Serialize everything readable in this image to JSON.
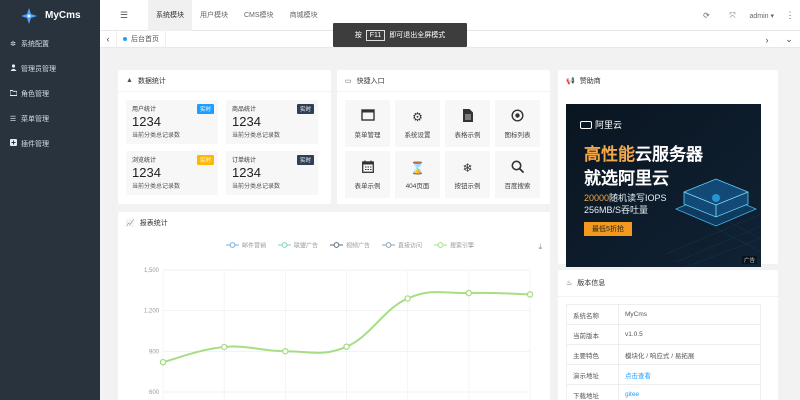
{
  "app": {
    "name": "MyCms"
  },
  "sidebar": {
    "items": [
      {
        "label": "系统配置",
        "icon": "gear-icon"
      },
      {
        "label": "管理员管理",
        "icon": "user-icon"
      },
      {
        "label": "角色管理",
        "icon": "folder-icon"
      },
      {
        "label": "菜单管理",
        "icon": "menu-icon"
      },
      {
        "label": "插件管理",
        "icon": "plus-box-icon"
      }
    ]
  },
  "topbar": {
    "tabs": [
      "系统模块",
      "用户模块",
      "CMS模块",
      "商城模块"
    ],
    "active_tab": "系统模块",
    "user": "admin"
  },
  "tabstrip": {
    "home_tab": "后台首页"
  },
  "toast": {
    "before": "按",
    "key": "F11",
    "after": "即可退出全屏模式"
  },
  "stats": {
    "title": "数据统计",
    "items": [
      {
        "label": "用户统计",
        "badge": "实时",
        "badge_color": "#1e9fff",
        "value": "1234",
        "desc": "当前分类总记录数"
      },
      {
        "label": "商品统计",
        "badge": "实时",
        "badge_color": "#2f4056",
        "value": "1234",
        "desc": "当前分类总记录数"
      },
      {
        "label": "浏览统计",
        "badge": "实时",
        "badge_color": "#ffb800",
        "value": "1234",
        "desc": "当前分类总记录数"
      },
      {
        "label": "订单统计",
        "badge": "实时",
        "badge_color": "#2f4056",
        "value": "1234",
        "desc": "当前分类总记录数"
      }
    ]
  },
  "quick": {
    "title": "快捷入口",
    "items": [
      {
        "label": "菜单管理",
        "icon": "window-icon"
      },
      {
        "label": "系统设置",
        "icon": "gears-icon"
      },
      {
        "label": "表格示例",
        "icon": "file-icon"
      },
      {
        "label": "图标列表",
        "icon": "target-icon"
      },
      {
        "label": "表单示例",
        "icon": "calendar-icon"
      },
      {
        "label": "404页面",
        "icon": "hourglass-icon"
      },
      {
        "label": "按钮示例",
        "icon": "snowflake-icon"
      },
      {
        "label": "百度搜索",
        "icon": "search-icon"
      }
    ]
  },
  "sponsor": {
    "title": "赞助商",
    "brand": "阿里云",
    "headline_hl": "高性能",
    "headline_rest": "云服务器",
    "headline2": "就选阿里云",
    "line1_num": "20000",
    "line1_rest": "随机读写IOPS",
    "line2": "256MB/S吞吐量",
    "button": "最低5折抢",
    "ad_tag": "广告"
  },
  "version": {
    "title": "版本信息",
    "rows": [
      {
        "k": "系统名称",
        "v": "MyCms",
        "link": false
      },
      {
        "k": "当前版本",
        "v": "v1.0.5",
        "link": false
      },
      {
        "k": "主要特色",
        "v": "模块化 / 响应式 / 易拓展",
        "link": false
      },
      {
        "k": "演示地址",
        "v": "点击查看",
        "link": true
      },
      {
        "k": "下载地址",
        "v": "gitee",
        "link": true
      }
    ]
  },
  "report": {
    "title": "报表统计"
  },
  "chart_data": {
    "type": "line",
    "title": "",
    "legend": [
      "邮件营销",
      "联盟广告",
      "视频广告",
      "直接访问",
      "搜索引擎"
    ],
    "legend_colors": [
      "#6fb3e0",
      "#7fd3c0",
      "#5a6b7d",
      "#8aa1b4",
      "#a7dd87"
    ],
    "legend_position": "top-center",
    "yticks": [
      "1,500",
      "1,200",
      "900",
      "600"
    ],
    "ylim": [
      600,
      1500
    ],
    "grid": true,
    "series": [
      {
        "name": "搜索引擎",
        "color": "#a7dd87",
        "values": [
          820,
          932,
          901,
          934,
          1290,
          1330,
          1320
        ]
      }
    ]
  }
}
